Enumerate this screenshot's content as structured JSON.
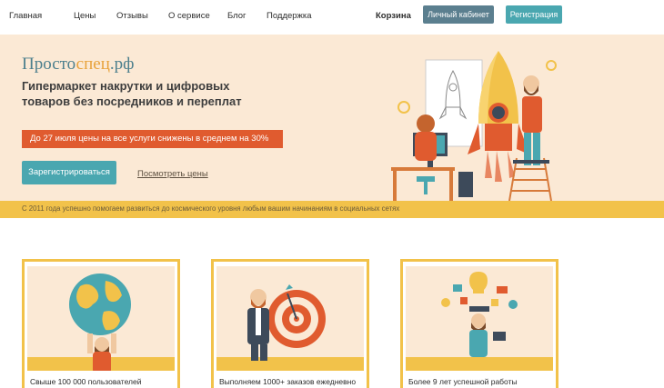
{
  "nav": {
    "items": [
      {
        "label": "Главная"
      },
      {
        "label": "Цены"
      },
      {
        "label": "Отзывы"
      },
      {
        "label": "О сервисе"
      },
      {
        "label": "Блог"
      },
      {
        "label": "Поддержка"
      }
    ],
    "cart_label": "Корзина",
    "cabinet_label": "Личный кабинет",
    "register_label": "Регистрация"
  },
  "hero": {
    "logo": {
      "part1": "Просто",
      "part2": "спец",
      "part3": ".рф"
    },
    "tagline": "Гипермаркет накрутки и цифровых товаров без посредников и переплат",
    "promo": "До 27 июля цены на все услуги снижены в среднем на 30%",
    "signup_label": "Зарегистрироваться",
    "prices_link": "Посмотреть цены"
  },
  "strip": {
    "text": "С 2011 года успешно помогаем развиться до космического уровня любым вашим начинаниям в социальных сетях"
  },
  "features": [
    {
      "caption": "Свыше 100 000 пользователей",
      "icon": "globe-man-icon"
    },
    {
      "caption": "Выполняем 1000+ заказов ежедневно",
      "icon": "target-man-icon"
    },
    {
      "caption": "Более 9 лет успешной работы",
      "icon": "idea-man-icon"
    }
  ],
  "colors": {
    "accent": "#4aa7b0",
    "promo": "#e05b2f",
    "strip": "#f2c24a",
    "hero_bg": "#fbe9d5",
    "cabinet": "#5b7f8f"
  }
}
